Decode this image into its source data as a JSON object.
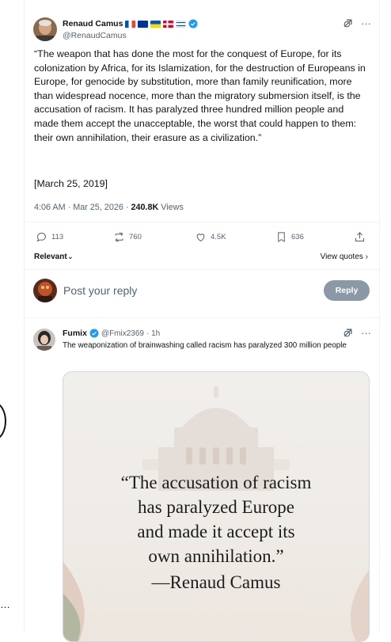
{
  "tweet": {
    "author_name": "Renaud Camus",
    "author_handle": "@RenaudCamus",
    "text": "“The weapon that has done the most for the conquest of Europe, for its colonization by Africa, for its Islamization, for the destruction of Europeans in Europe, for genocide by substitution, more than family reunification, more than widespread nocence, more than the migratory submersion itself, is the accusation of racism. It has paralyzed three hundred million people and made them accept the unacceptable, the worst that could happen to them: their own annihilation, their erasure as a civilization.”",
    "date_line": "[March 25, 2019]",
    "time": "4:06 AM · Mar 25, 2026 · ",
    "views_count": "240.8K",
    "views_label": " Views",
    "replies": "113",
    "reposts": "760",
    "likes": "4.5K",
    "bookmarks": "636"
  },
  "sort": {
    "label": "Relevant",
    "view_quotes": "View quotes"
  },
  "composer": {
    "placeholder": "Post your reply",
    "button": "Reply"
  },
  "reply": {
    "author_name": "Fumix",
    "author_handle": "@Fmix2369",
    "time": "· 1h",
    "text": "The weaponization of brainwashing called racism has paralyzed 300 million people",
    "image_quote": [
      "“The accusation of racism",
      "has paralyzed Europe",
      "and made it accept its",
      "own annihilation.”",
      "—Renaud Camus"
    ]
  },
  "colors": {
    "verified": "#1d9bf0",
    "reply_button": "#8b98a5",
    "muted": "#536471"
  },
  "icons": [
    "grok-icon",
    "more-icon",
    "reply-icon",
    "repost-icon",
    "like-icon",
    "bookmark-icon",
    "share-icon",
    "verified-icon"
  ]
}
